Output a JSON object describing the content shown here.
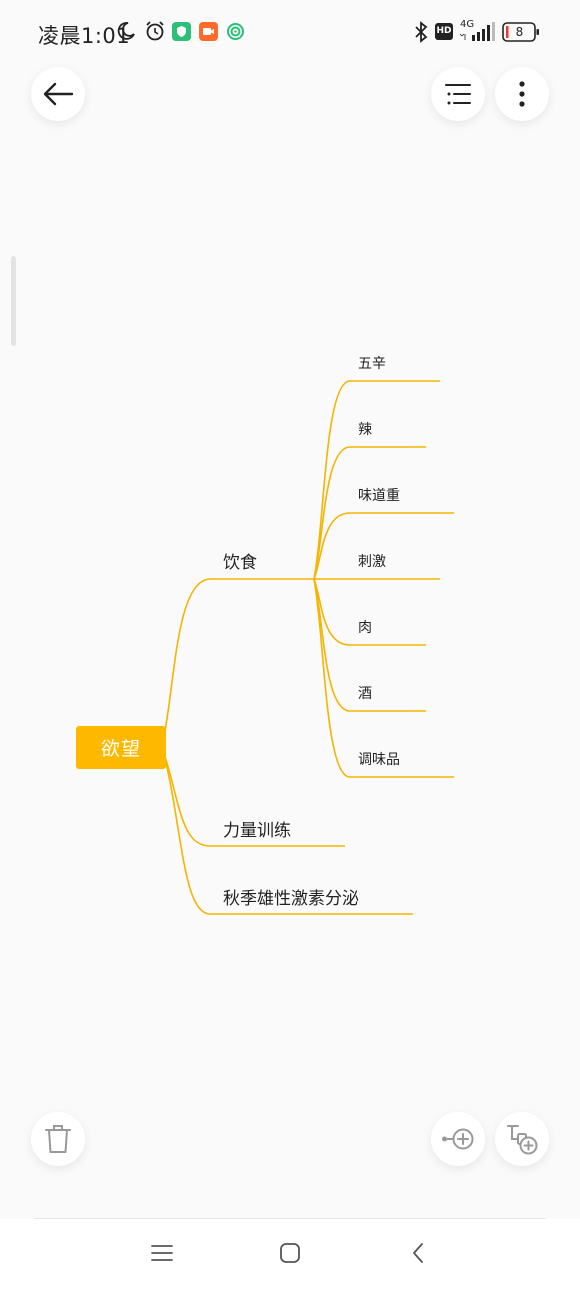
{
  "status_bar": {
    "time": "凌晨1:01",
    "network": "4G",
    "hd": "HD",
    "battery": "8"
  },
  "mindmap": {
    "root": "欲望",
    "branches": [
      {
        "label": "饮食",
        "children": [
          "五辛",
          "辣",
          "味道重",
          "刺激",
          "肉",
          "酒",
          "调味品"
        ]
      },
      {
        "label": "力量训练",
        "children": []
      },
      {
        "label": "秋季雄性激素分泌",
        "children": []
      }
    ]
  },
  "colors": {
    "accent": "#ffb800",
    "line": "#f5b400",
    "background": "#fafafa"
  },
  "icons": {
    "back": "arrow-left-icon",
    "outline": "list-icon",
    "more": "more-vertical-icon",
    "delete": "trash-icon",
    "add_sibling": "add-sibling-node-icon",
    "add_child": "add-child-node-icon"
  }
}
